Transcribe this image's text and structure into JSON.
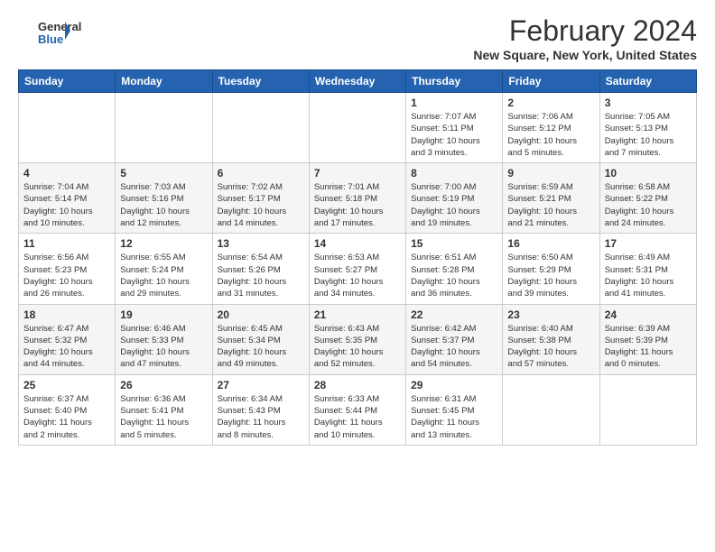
{
  "logo": {
    "line1": "General",
    "line2": "Blue"
  },
  "title": "February 2024",
  "subtitle": "New Square, New York, United States",
  "days_of_week": [
    "Sunday",
    "Monday",
    "Tuesday",
    "Wednesday",
    "Thursday",
    "Friday",
    "Saturday"
  ],
  "weeks": [
    [
      {
        "day": "",
        "info": ""
      },
      {
        "day": "",
        "info": ""
      },
      {
        "day": "",
        "info": ""
      },
      {
        "day": "",
        "info": ""
      },
      {
        "day": "1",
        "info": "Sunrise: 7:07 AM\nSunset: 5:11 PM\nDaylight: 10 hours\nand 3 minutes."
      },
      {
        "day": "2",
        "info": "Sunrise: 7:06 AM\nSunset: 5:12 PM\nDaylight: 10 hours\nand 5 minutes."
      },
      {
        "day": "3",
        "info": "Sunrise: 7:05 AM\nSunset: 5:13 PM\nDaylight: 10 hours\nand 7 minutes."
      }
    ],
    [
      {
        "day": "4",
        "info": "Sunrise: 7:04 AM\nSunset: 5:14 PM\nDaylight: 10 hours\nand 10 minutes."
      },
      {
        "day": "5",
        "info": "Sunrise: 7:03 AM\nSunset: 5:16 PM\nDaylight: 10 hours\nand 12 minutes."
      },
      {
        "day": "6",
        "info": "Sunrise: 7:02 AM\nSunset: 5:17 PM\nDaylight: 10 hours\nand 14 minutes."
      },
      {
        "day": "7",
        "info": "Sunrise: 7:01 AM\nSunset: 5:18 PM\nDaylight: 10 hours\nand 17 minutes."
      },
      {
        "day": "8",
        "info": "Sunrise: 7:00 AM\nSunset: 5:19 PM\nDaylight: 10 hours\nand 19 minutes."
      },
      {
        "day": "9",
        "info": "Sunrise: 6:59 AM\nSunset: 5:21 PM\nDaylight: 10 hours\nand 21 minutes."
      },
      {
        "day": "10",
        "info": "Sunrise: 6:58 AM\nSunset: 5:22 PM\nDaylight: 10 hours\nand 24 minutes."
      }
    ],
    [
      {
        "day": "11",
        "info": "Sunrise: 6:56 AM\nSunset: 5:23 PM\nDaylight: 10 hours\nand 26 minutes."
      },
      {
        "day": "12",
        "info": "Sunrise: 6:55 AM\nSunset: 5:24 PM\nDaylight: 10 hours\nand 29 minutes."
      },
      {
        "day": "13",
        "info": "Sunrise: 6:54 AM\nSunset: 5:26 PM\nDaylight: 10 hours\nand 31 minutes."
      },
      {
        "day": "14",
        "info": "Sunrise: 6:53 AM\nSunset: 5:27 PM\nDaylight: 10 hours\nand 34 minutes."
      },
      {
        "day": "15",
        "info": "Sunrise: 6:51 AM\nSunset: 5:28 PM\nDaylight: 10 hours\nand 36 minutes."
      },
      {
        "day": "16",
        "info": "Sunrise: 6:50 AM\nSunset: 5:29 PM\nDaylight: 10 hours\nand 39 minutes."
      },
      {
        "day": "17",
        "info": "Sunrise: 6:49 AM\nSunset: 5:31 PM\nDaylight: 10 hours\nand 41 minutes."
      }
    ],
    [
      {
        "day": "18",
        "info": "Sunrise: 6:47 AM\nSunset: 5:32 PM\nDaylight: 10 hours\nand 44 minutes."
      },
      {
        "day": "19",
        "info": "Sunrise: 6:46 AM\nSunset: 5:33 PM\nDaylight: 10 hours\nand 47 minutes."
      },
      {
        "day": "20",
        "info": "Sunrise: 6:45 AM\nSunset: 5:34 PM\nDaylight: 10 hours\nand 49 minutes."
      },
      {
        "day": "21",
        "info": "Sunrise: 6:43 AM\nSunset: 5:35 PM\nDaylight: 10 hours\nand 52 minutes."
      },
      {
        "day": "22",
        "info": "Sunrise: 6:42 AM\nSunset: 5:37 PM\nDaylight: 10 hours\nand 54 minutes."
      },
      {
        "day": "23",
        "info": "Sunrise: 6:40 AM\nSunset: 5:38 PM\nDaylight: 10 hours\nand 57 minutes."
      },
      {
        "day": "24",
        "info": "Sunrise: 6:39 AM\nSunset: 5:39 PM\nDaylight: 11 hours\nand 0 minutes."
      }
    ],
    [
      {
        "day": "25",
        "info": "Sunrise: 6:37 AM\nSunset: 5:40 PM\nDaylight: 11 hours\nand 2 minutes."
      },
      {
        "day": "26",
        "info": "Sunrise: 6:36 AM\nSunset: 5:41 PM\nDaylight: 11 hours\nand 5 minutes."
      },
      {
        "day": "27",
        "info": "Sunrise: 6:34 AM\nSunset: 5:43 PM\nDaylight: 11 hours\nand 8 minutes."
      },
      {
        "day": "28",
        "info": "Sunrise: 6:33 AM\nSunset: 5:44 PM\nDaylight: 11 hours\nand 10 minutes."
      },
      {
        "day": "29",
        "info": "Sunrise: 6:31 AM\nSunset: 5:45 PM\nDaylight: 11 hours\nand 13 minutes."
      },
      {
        "day": "",
        "info": ""
      },
      {
        "day": "",
        "info": ""
      }
    ]
  ]
}
